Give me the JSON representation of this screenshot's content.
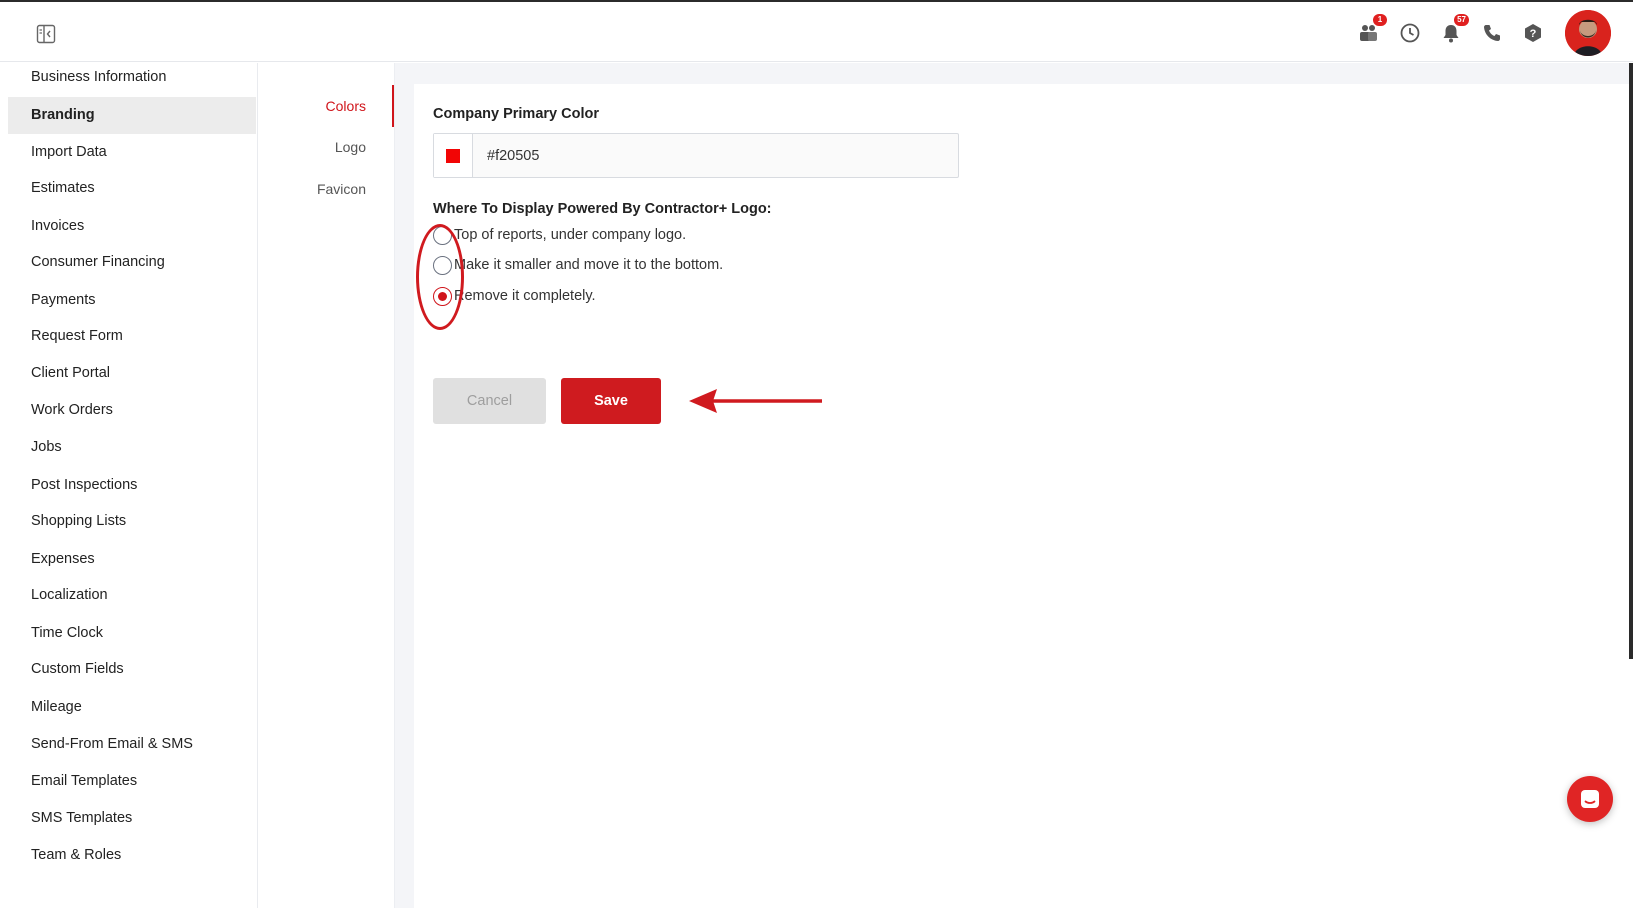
{
  "header": {
    "icons": [
      {
        "name": "team-icon",
        "badge": "1"
      },
      {
        "name": "clock-icon",
        "badge": null
      },
      {
        "name": "bell-icon",
        "badge": "57"
      },
      {
        "name": "phone-icon",
        "badge": null
      },
      {
        "name": "help-icon",
        "badge": null
      }
    ]
  },
  "sidebar": {
    "items": [
      {
        "label": "Business Information"
      },
      {
        "label": "Branding",
        "active": true
      },
      {
        "label": "Import Data"
      },
      {
        "label": "Estimates"
      },
      {
        "label": "Invoices"
      },
      {
        "label": "Consumer Financing"
      },
      {
        "label": "Payments"
      },
      {
        "label": "Request Form"
      },
      {
        "label": "Client Portal"
      },
      {
        "label": "Work Orders"
      },
      {
        "label": "Jobs"
      },
      {
        "label": "Post Inspections"
      },
      {
        "label": "Shopping Lists"
      },
      {
        "label": "Expenses"
      },
      {
        "label": "Localization"
      },
      {
        "label": "Time Clock"
      },
      {
        "label": "Custom Fields"
      },
      {
        "label": "Mileage"
      },
      {
        "label": "Send-From Email & SMS"
      },
      {
        "label": "Email Templates"
      },
      {
        "label": "SMS Templates"
      },
      {
        "label": "Team & Roles"
      }
    ]
  },
  "subnav": {
    "items": [
      {
        "label": "Colors",
        "active": true
      },
      {
        "label": "Logo"
      },
      {
        "label": "Favicon"
      }
    ]
  },
  "form": {
    "primary_color_label": "Company Primary Color",
    "primary_color_value": "#f20505",
    "swatch_color": "#f20505",
    "display_question": "Where To Display Powered By Contractor+ Logo:",
    "options": [
      {
        "label": "Top of reports, under company logo.",
        "checked": false
      },
      {
        "label": "Make it smaller and move it to the bottom.",
        "checked": false
      },
      {
        "label": "Remove it completely.",
        "checked": true
      }
    ],
    "cancel_label": "Cancel",
    "save_label": "Save"
  },
  "colors": {
    "accent": "#cf1b1f",
    "annotation": "#d01a1f"
  }
}
